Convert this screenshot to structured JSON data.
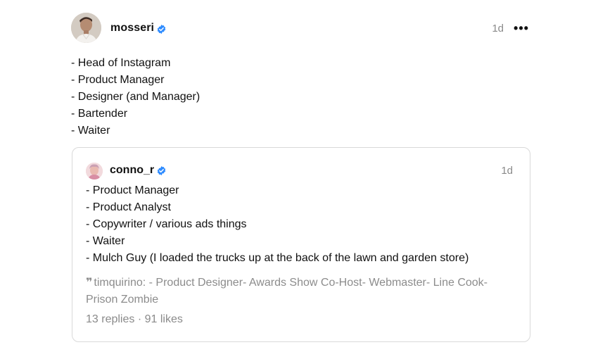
{
  "post": {
    "username": "mosseri",
    "time": "1d",
    "more_label": "•••",
    "lines": [
      "- Head of Instagram",
      "- Product Manager",
      "- Designer (and Manager)",
      "- Bartender",
      "- Waiter"
    ]
  },
  "quoted": {
    "username": "conno_r",
    "time": "1d",
    "lines": [
      "- Product Manager",
      "- Product Analyst",
      "- Copywriter / various ads things",
      "- Waiter",
      "- Mulch Guy (I loaded the trucks up at the back of the lawn and garden store)"
    ],
    "reply_preview": "timquirino: - Product Designer- Awards Show Co-Host- Webmaster- Line Cook- Prison Zombie",
    "replies": "13 replies",
    "separator": " · ",
    "likes": "91 likes"
  },
  "icons": {
    "verified": "verified-badge-icon",
    "more": "more-options-icon",
    "quote": "quote-icon"
  },
  "colors": {
    "verified": "#2f8cff",
    "muted": "#8a8a8a",
    "border": "#d9d9d9"
  }
}
